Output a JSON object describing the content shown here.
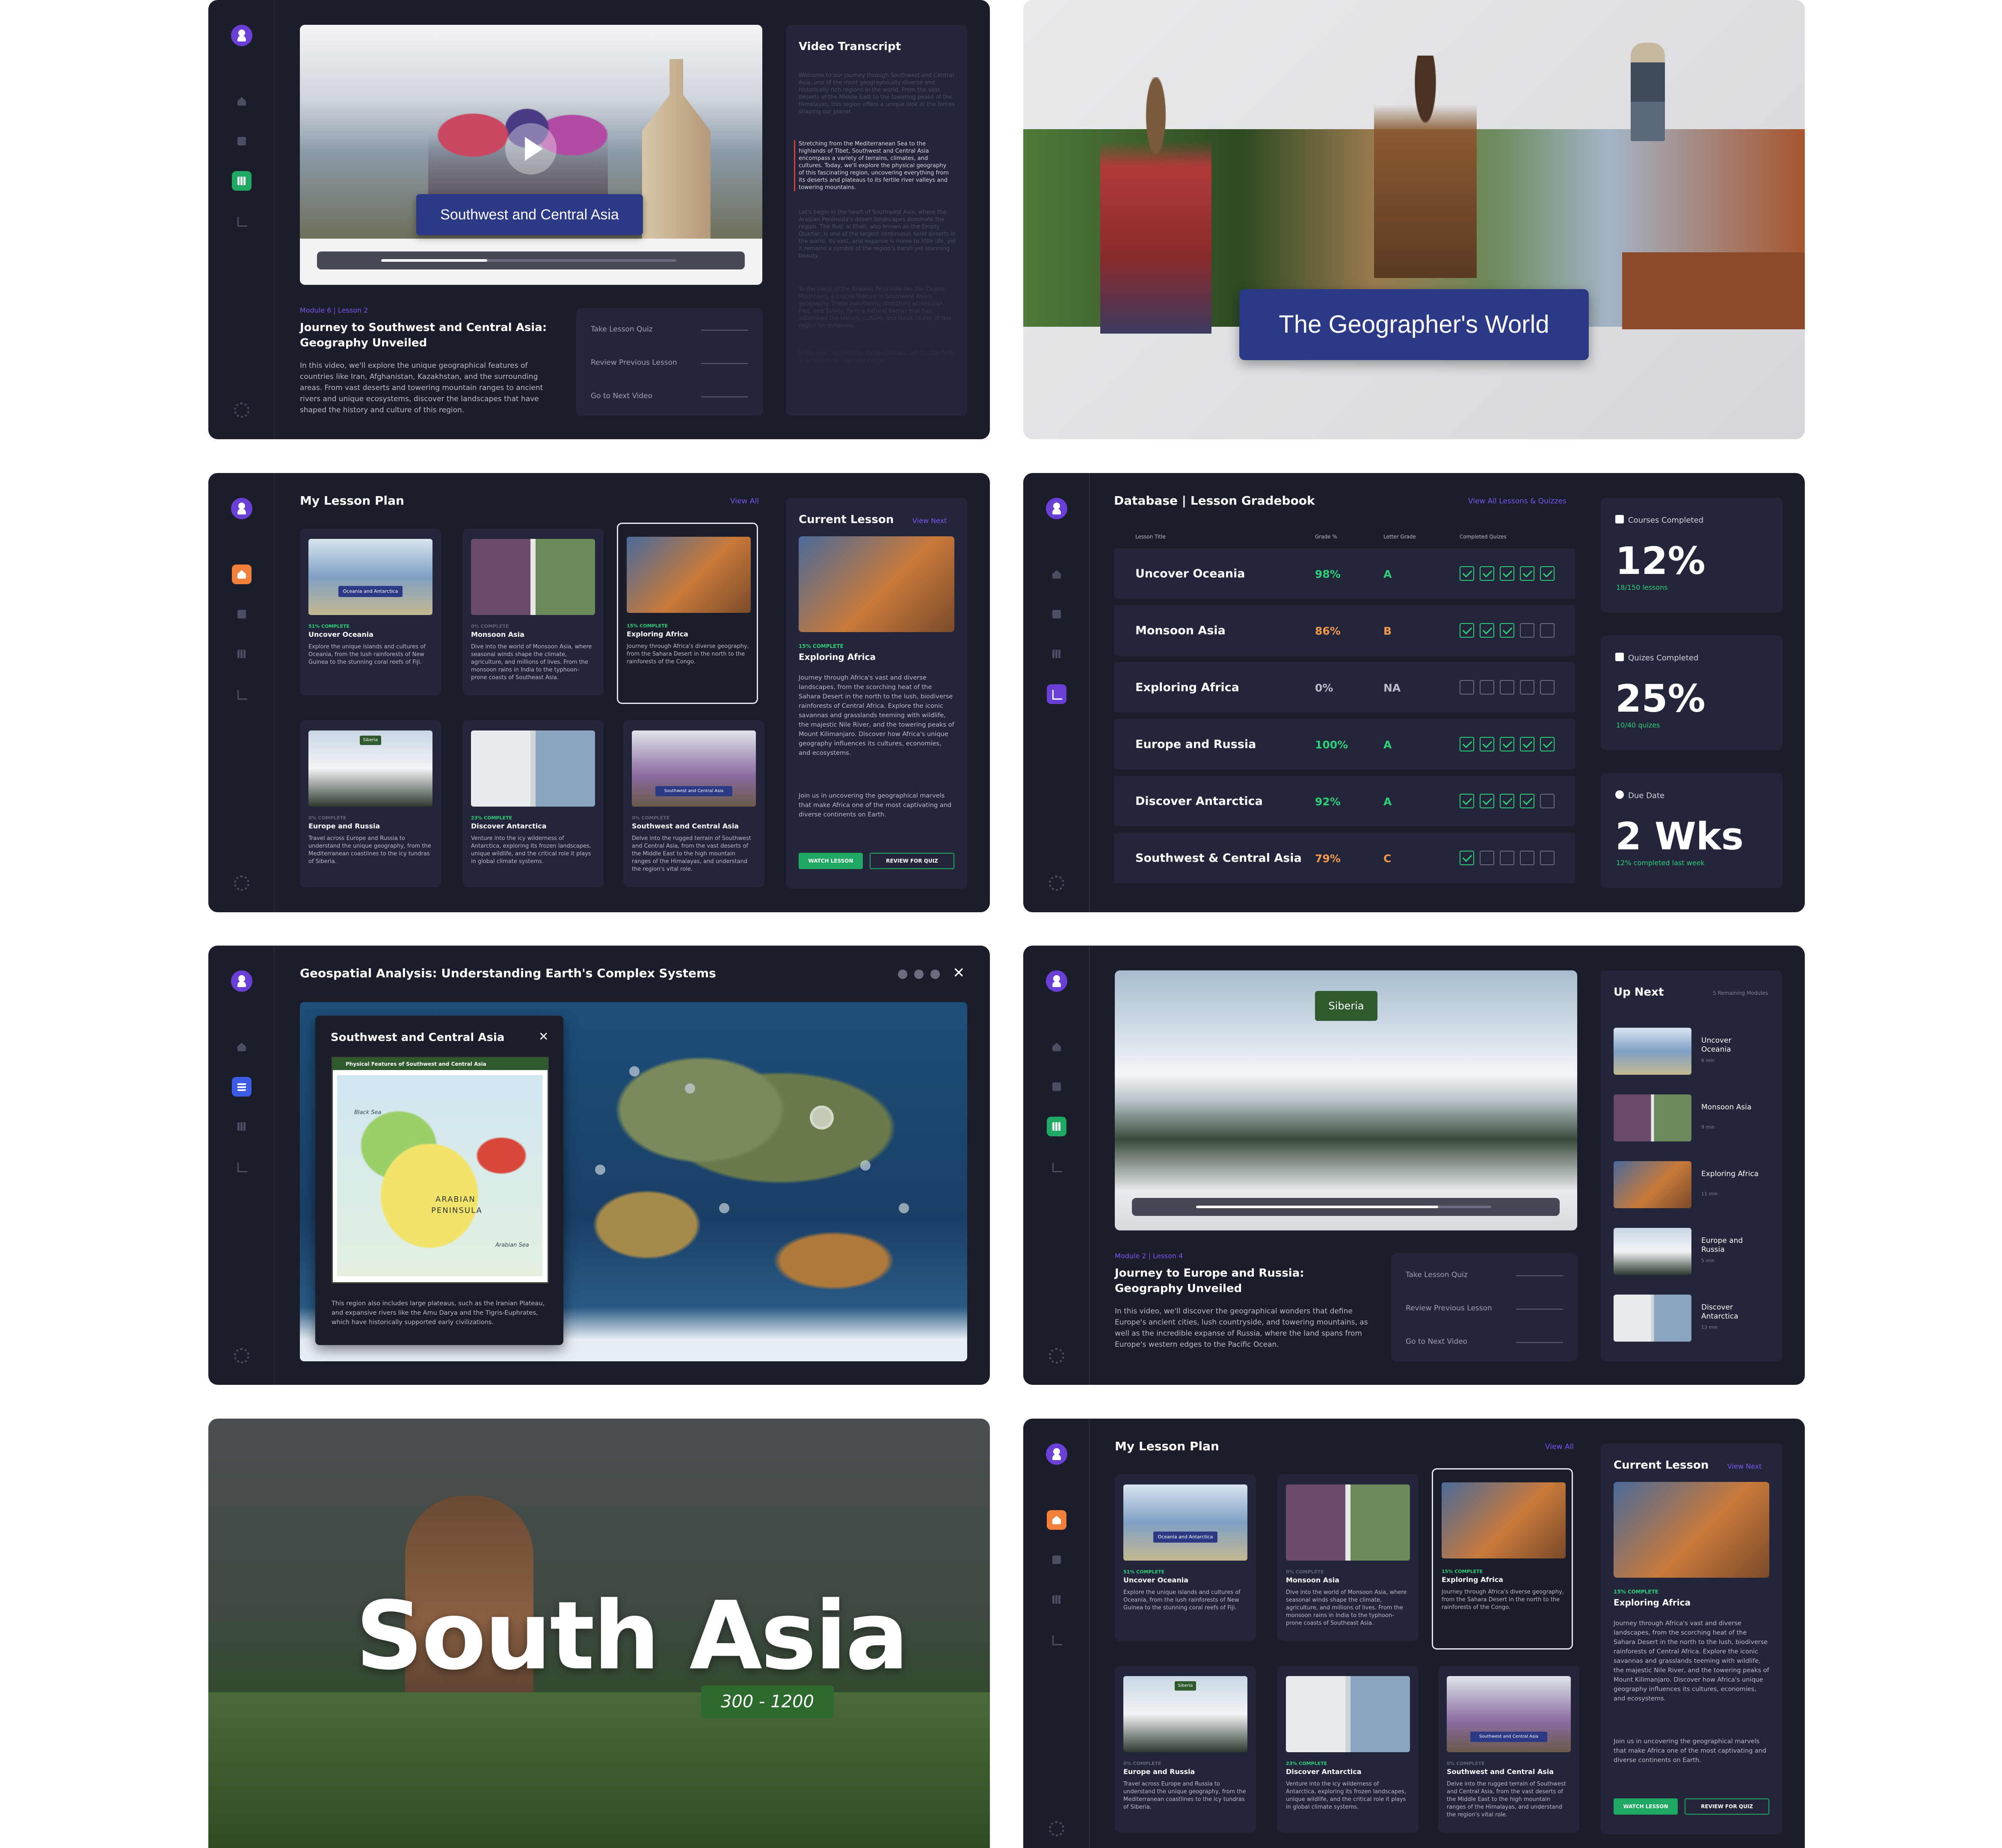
{
  "p1": {
    "video_title": "Southwest and Central Asia",
    "module": "Module 6 | Lesson 2",
    "title": "Journey to Southwest and Central Asia: Geography Unveiled",
    "desc": "In this video, we'll explore the unique geographical features of countries like Iran, Afghanistan, Kazakhstan, and the surrounding areas. From vast deserts and towering mountain ranges to ancient rivers and unique ecosystems, discover the landscapes that have shaped the history and culture of this region.",
    "actions": [
      "Take Lesson Quiz",
      "Review Previous Lesson",
      "Go to Next Video"
    ],
    "transcript_title": "Video Transcript",
    "transcript": [
      "Welcome to our journey through Southwest and Central Asia, one of the most geographically diverse and historically rich regions in the world. From the vast deserts of the Middle East to the towering peaks of the Himalayas, this region offers a unique look at the forces shaping our planet.",
      "Stretching from the Mediterranean Sea to the highlands of Tibet, Southwest and Central Asia encompass a variety of terrains, climates, and cultures. Today, we'll explore the physical geography of this fascinating region, uncovering everything from its deserts and plateaus to its fertile river valleys and towering mountains.",
      "Let's begin in the heart of Southwest Asia, where the Arabian Peninsula's desert landscapes dominate the region. The Rub' al Khali, also known as the Empty Quarter, is one of the largest continuous sand deserts in the world. Its vast, arid expanse is home to little life, yet it remains a symbol of the region's harsh yet stunning beauty.",
      "To the north of the Arabian Peninsula lies the Zagros Mountains, a crucial feature in Southwest Asia's geography. These mountains, stretching across Iran, Iraq, and Turkey, form a natural barrier that has influenced the history, culture, and trade routes of this region for millennia.",
      "In the east, we find the Iranian Plateau, which stands in a surrounding mountain ranges."
    ]
  },
  "p2": {
    "title": "The Geographer's World"
  },
  "p3": {
    "heading": "My Lesson Plan",
    "view_all": "View All",
    "lessons": [
      {
        "pct": "51% COMPLETE",
        "title": "Uncover Oceania",
        "desc": "Explore the unique islands and cultures of Oceania, from the lush rainforests of New Guinea to the stunning coral reefs of Fiji.",
        "thumb_label": "Oceania and Antarctica"
      },
      {
        "pct": "0% COMPLETE",
        "title": "Monsoon Asia",
        "desc": "Dive into the world of Monsoon Asia, where seasonal winds shape the climate, agriculture, and millions of lives. From the monsoon rains in India to the typhoon-prone coasts of Southeast Asia."
      },
      {
        "pct": "15% COMPLETE",
        "title": "Exploring Africa",
        "desc": "Journey through Africa's diverse geography, from the Sahara Desert in the north to the rainforests of the Congo."
      },
      {
        "pct": "0% COMPLETE",
        "title": "Europe and Russia",
        "desc": "Travel across Europe and Russia to understand the unique geography, from the Mediterranean coastlines to the icy tundras of Siberia.",
        "thumb_label": "Siberia"
      },
      {
        "pct": "23% COMPLETE",
        "title": "Discover Antarctica",
        "desc": "Venture into the icy wilderness of Antarctica, exploring its frozen landscapes, unique wildlife, and the critical role it plays in global climate systems."
      },
      {
        "pct": "0% COMPLETE",
        "title": "Southwest and Central Asia",
        "desc": "Delve into the rugged terrain of Southwest and Central Asia, from the vast deserts of the Middle East to the high mountain ranges of the Himalayas, and understand the region's vital role.",
        "thumb_label": "Southwest and Central Asia"
      }
    ],
    "current": {
      "heading": "Current Lesson",
      "view_next": "View Next",
      "pct": "15% COMPLETE",
      "title": "Exploring Africa",
      "desc1": "Journey through Africa's vast and diverse landscapes, from the scorching heat of the Sahara Desert in the north to the lush, biodiverse rainforests of Central Africa. Explore the iconic savannas and grasslands teeming with wildlife, the majestic Nile River, and the towering peaks of Mount Kilimanjaro. Discover how Africa's unique geography influences its cultures, economies, and ecosystems.",
      "desc2": "Join us in uncovering the geographical marvels that make Africa one of the most captivating and diverse continents on Earth.",
      "watch": "WATCH LESSON",
      "review": "REVIEW FOR QUIZ"
    }
  },
  "p4": {
    "heading": "Database | Lesson Gradebook",
    "view_all": "View All Lessons & Quizzes",
    "cols": [
      "Lesson Title",
      "Grade %",
      "Letter Grade",
      "Completed Quizes"
    ],
    "rows": [
      {
        "name": "Uncover Oceania",
        "grade": "98%",
        "letter": "A",
        "quizzes": 5,
        "tone": "green"
      },
      {
        "name": "Monsoon Asia",
        "grade": "86%",
        "letter": "B",
        "quizzes": 3,
        "tone": "orange"
      },
      {
        "name": "Exploring Africa",
        "grade": "0%",
        "letter": "NA",
        "quizzes": 0,
        "tone": "gray"
      },
      {
        "name": "Europe and Russia",
        "grade": "100%",
        "letter": "A",
        "quizzes": 5,
        "tone": "green"
      },
      {
        "name": "Discover Antarctica",
        "grade": "92%",
        "letter": "A",
        "quizzes": 4,
        "tone": "green"
      },
      {
        "name": "Southwest & Central Asia",
        "grade": "79%",
        "letter": "C",
        "quizzes": 1,
        "tone": "orange"
      }
    ],
    "stats": [
      {
        "label": "Courses Completed",
        "value": "12%",
        "sub": "18/150 lessons"
      },
      {
        "label": "Quizes Completed",
        "value": "25%",
        "sub": "10/40 quizes"
      },
      {
        "label": "Due Date",
        "value": "2 Wks",
        "sub": "12% completed last week"
      }
    ]
  },
  "p5": {
    "title": "Geospatial Analysis: Understanding Earth's Complex Systems",
    "popup_title": "Southwest and Central Asia",
    "map_title": "Physical Features of Southwest and Central Asia",
    "map_labels": [
      "ARABIAN",
      "PENINSULA",
      "Arabian Sea",
      "Black Sea"
    ],
    "popup_desc": "This region also includes large plateaus, such as the Iranian Plateau, and expansive rivers like the Amu Darya and the Tigris-Euphrates, which have historically supported early civilizations."
  },
  "p6": {
    "video_label": "Siberia",
    "module": "Module 2 | Lesson 4",
    "title": "Journey to Europe and Russia: Geography Unveiled",
    "desc": "In this video, we'll discover the geographical wonders that define Europe's ancient cities, lush countryside, and towering mountains, as well as the incredible expanse of Russia, where the land spans from Europe's western edges to the Pacific Ocean.",
    "actions": [
      "Take Lesson Quiz",
      "Review Previous Lesson",
      "Go to Next Video"
    ],
    "up_next": "Up Next",
    "remaining": "5 Remaining Modules",
    "items": [
      {
        "name": "Uncover Oceania",
        "min": "6 min"
      },
      {
        "name": "Monsoon Asia",
        "min": "9 min"
      },
      {
        "name": "Exploring Africa",
        "min": "11 min"
      },
      {
        "name": "Europe and Russia",
        "min": "5 min"
      },
      {
        "name": "Discover Antarctica",
        "min": "13 min"
      }
    ]
  },
  "p7": {
    "title": "South Asia",
    "years": "300 - 1200"
  },
  "colors": {
    "accent": "#6a3fd6",
    "green": "#1fa862",
    "bg": "#1b1d2b",
    "card": "#23263a",
    "banner": "#2c3a86"
  }
}
